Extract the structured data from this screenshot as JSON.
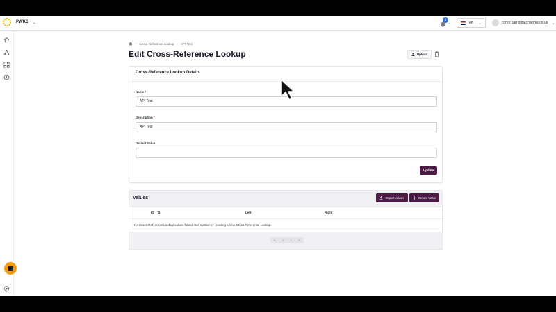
{
  "topbar": {
    "brand": "PWKS",
    "notification_count": "1",
    "language": "en",
    "user_email": "conor.barr@patchworks.co.uk"
  },
  "sidebar": {
    "items": [
      "home-icon",
      "network-icon",
      "grid-icon",
      "help-icon",
      "settings-icon"
    ]
  },
  "breadcrumb": {
    "items": [
      "Cross-Reference Lookup",
      "API Test"
    ]
  },
  "page": {
    "title": "Edit Cross-Reference Lookup",
    "upload_label": "Upload"
  },
  "details": {
    "title": "Cross-Reference Lookup Details",
    "name_label": "Name",
    "name_value": "API Test",
    "description_label": "Description",
    "description_value": "API Test",
    "default_label": "Default Value",
    "default_value": "",
    "required_mark": "*",
    "update_label": "Update"
  },
  "values": {
    "title": "Values",
    "import_label": "Import values",
    "create_label": "Create Value",
    "columns": [
      "ID",
      "Left",
      "Right"
    ],
    "empty_message": "No Cross-Reference Lookup values found. Get started by creating a new Cross-Reference Lookup.",
    "pager": [
      "«",
      "‹",
      "›",
      "»"
    ]
  },
  "colors": {
    "accent": "#4b1b45",
    "badge": "#2d6cdf",
    "chat": "#f39c12"
  }
}
